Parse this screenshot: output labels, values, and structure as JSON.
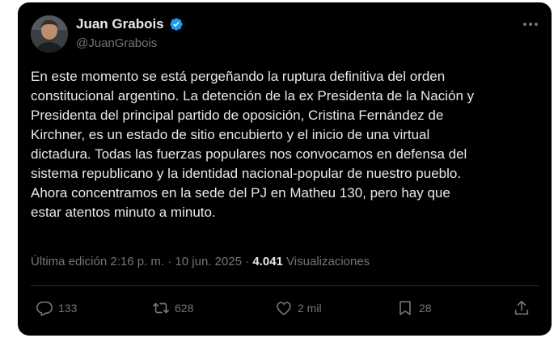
{
  "author": {
    "display_name": "Juan Grabois",
    "handle": "@JuanGrabois",
    "verified": true
  },
  "tweet": {
    "text": "En este momento se está pergeñando la ruptura definitiva del orden\nconstitucional argentino. La detención de la ex Presidenta de la Nación y\nPresidenta del principal partido de oposición, Cristina Fernández de\nKirchner, es un estado de sitio encubierto y el inicio de una virtual\ndictadura. Todas las fuerzas populares nos convocamos en defensa del\nsistema republicano y la identidad nacional-popular de nuestro pueblo.\nAhora concentramos en la sede del PJ en Matheu 130, pero hay que\nestar atentos minuto a minuto."
  },
  "meta": {
    "edited_label": "Última edición 2:16 p. m.",
    "separator": " · ",
    "date": "10 jun. 2025",
    "views_count": "4.041",
    "views_label": "Visualizaciones"
  },
  "actions": {
    "replies": "133",
    "retweets": "628",
    "likes": "2 mil",
    "bookmarks": "28"
  },
  "colors": {
    "background": "#000000",
    "text": "#e7e9ea",
    "secondary": "#71767b",
    "verified": "#1d9bf0",
    "divider": "#2f3336"
  },
  "icons": {
    "more": "more-dots-icon",
    "verified": "verified-badge-icon",
    "reply": "reply-icon",
    "retweet": "retweet-icon",
    "like": "heart-icon",
    "bookmark": "bookmark-icon",
    "share": "share-icon"
  }
}
